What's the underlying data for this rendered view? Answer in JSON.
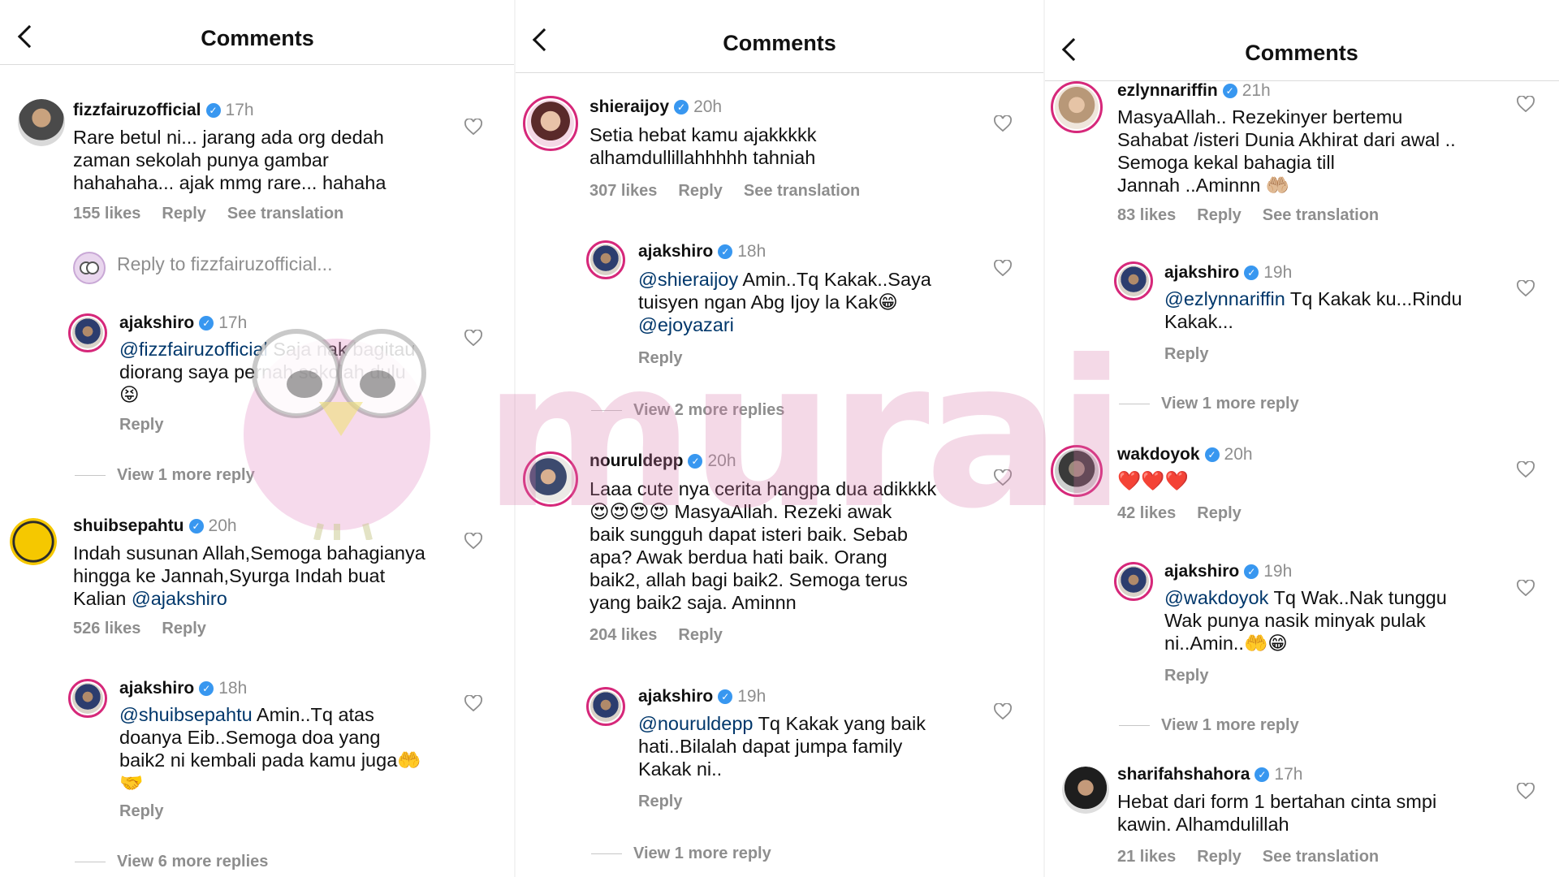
{
  "header": {
    "title": "Comments"
  },
  "panel1": {
    "c1": {
      "user": "fizzfairuzofficial",
      "time": "17h",
      "lines": [
        "Rare betul ni... jarang ada org dedah",
        "zaman sekolah punya gambar",
        "hahahaha... ajak mmg rare... hahaha"
      ],
      "likes": "155 likes",
      "reply": "Reply",
      "translate": "See translation"
    },
    "reply_to": "Reply to fizzfairuzofficial...",
    "r1": {
      "user": "ajakshiro",
      "time": "17h",
      "mention": "@fizzfairuzofficial",
      "text1": " Saja nak bagitau",
      "line2": "diorang saya pernah sekolah dulu",
      "line3": "😝",
      "reply": "Reply"
    },
    "more1": "View 1 more reply",
    "c2": {
      "user": "shuibsepahtu",
      "time": "20h",
      "line1": "Indah susunan Allah,Semoga bahagianya",
      "line2": "hingga ke Jannah,Syurga Indah buat",
      "line3": "Kalian ",
      "mention": "@ajakshiro",
      "likes": "526 likes",
      "reply": "Reply"
    },
    "r2": {
      "user": "ajakshiro",
      "time": "18h",
      "mention": "@shuibsepahtu",
      "text1": " Amin..Tq atas",
      "line2": "doanya Eib..Semoga doa yang",
      "line3": "baik2 ni kembali pada kamu juga🤲",
      "line4": "🤝",
      "reply": "Reply"
    },
    "more2": "View 6 more replies"
  },
  "panel2": {
    "c1": {
      "user": "shieraijoy",
      "time": "20h",
      "lines": [
        "Setia hebat kamu ajakkkkk",
        "alhamdullillahhhhh tahniah"
      ],
      "likes": "307 likes",
      "reply": "Reply",
      "translate": "See translation"
    },
    "r1": {
      "user": "ajakshiro",
      "time": "18h",
      "mention": "@shieraijoy",
      "text1": " Amin..Tq Kakak..Saya",
      "line2": "tuisyen ngan Abg Ijoy la Kak😁",
      "mention2": "@ejoyazari",
      "reply": "Reply"
    },
    "more1": "View 2 more replies",
    "c2": {
      "user": "nouruldepp",
      "time": "20h",
      "lines": [
        "Laaa cute nya cerita hangpa dua adikkkk",
        "😍😍😍😍 MasyaAllah. Rezeki awak",
        "baik sungguh dapat isteri baik. Sebab",
        "apa? Awak berdua hati baik. Orang",
        "baik2, allah bagi baik2. Semoga terus",
        "yang baik2 saja. Aminnn"
      ],
      "likes": "204 likes",
      "reply": "Reply"
    },
    "r2": {
      "user": "ajakshiro",
      "time": "19h",
      "mention": "@nouruldepp",
      "text1": " Tq Kakak yang baik",
      "line2": "hati..Bilalah dapat jumpa family",
      "line3": "Kakak ni..",
      "reply": "Reply"
    },
    "more2": "View 1 more reply"
  },
  "panel3": {
    "c1": {
      "user": "ezlynnariffin",
      "time": "21h",
      "lines": [
        "MasyaAllah.. Rezekinyer bertemu",
        "Sahabat /isteri Dunia Akhirat dari awal ..",
        "Semoga kekal bahagia till",
        "Jannah ..Aminnn 🤲🏼"
      ],
      "likes": "83 likes",
      "reply": "Reply",
      "translate": "See translation"
    },
    "r1": {
      "user": "ajakshiro",
      "time": "19h",
      "mention": "@ezlynnariffin",
      "text1": " Tq Kakak ku...Rindu",
      "line2": "Kakak...",
      "reply": "Reply"
    },
    "more1": "View 1 more reply",
    "c2": {
      "user": "wakdoyok",
      "time": "20h",
      "line1": "❤️❤️❤️",
      "likes": "42 likes",
      "reply": "Reply"
    },
    "r2": {
      "user": "ajakshiro",
      "time": "19h",
      "mention": "@wakdoyok",
      "text1": " Tq Wak..Nak tunggu",
      "line2": "Wak punya nasik minyak pulak",
      "line3": "ni..Amin..🤲😁",
      "reply": "Reply"
    },
    "more2": "View 1 more reply",
    "c3": {
      "user": "sharifahshahora",
      "time": "17h",
      "lines": [
        "Hebat dari form 1 bertahan cinta smpi",
        "kawin. Alhamdulillah"
      ],
      "likes": "21 likes",
      "reply": "Reply",
      "translate": "See translation"
    }
  },
  "watermark": "murai"
}
